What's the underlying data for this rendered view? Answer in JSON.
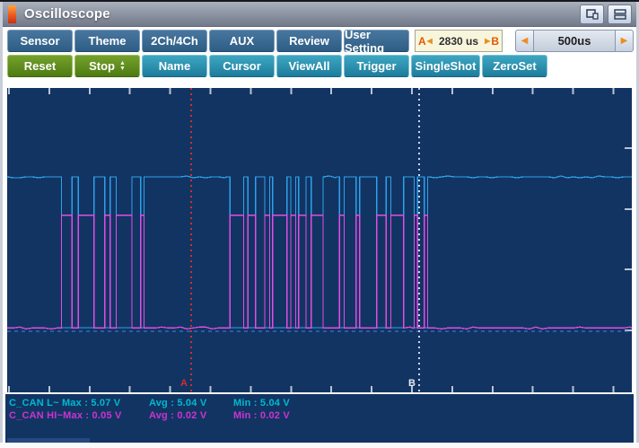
{
  "window": {
    "title": "Oscilloscope"
  },
  "icons": {
    "left_arrow": "◀",
    "right_arrow": "▶",
    "spinner_up": "▲",
    "spinner_down": "▼"
  },
  "toolbar": {
    "row1": [
      {
        "label": "Sensor"
      },
      {
        "label": "Theme"
      },
      {
        "label": "2Ch/4Ch"
      },
      {
        "label": "AUX"
      },
      {
        "label": "Review"
      },
      {
        "label": "User Setting"
      }
    ],
    "ab_readout": {
      "a": "A",
      "value": "2830 us",
      "b": "B"
    },
    "timebase": {
      "value": "500us"
    },
    "row2": [
      {
        "label": "Reset"
      },
      {
        "label": "Stop"
      },
      {
        "label": "Name"
      },
      {
        "label": "Cursor"
      },
      {
        "label": "ViewAll"
      },
      {
        "label": "Trigger"
      },
      {
        "label": "SingleShot"
      },
      {
        "label": "ZeroSet"
      }
    ]
  },
  "status": {
    "rows": [
      {
        "label_max": "C_CAN L~ Max : 5.07 V",
        "avg": "Avg : 5.04 V",
        "min": "Min : 5.04 V",
        "color": "#00bacf"
      },
      {
        "label_max": "C_CAN HI~Max : 0.05 V",
        "avg": "Avg : 0.02 V",
        "min": "Min : 0.02 V",
        "color": "#cd33d0"
      }
    ]
  },
  "chart_data": {
    "type": "line",
    "x_unit": "us",
    "time_span_us": 7750,
    "timebase_per_div": "500us",
    "cursor_delta": "2830 us",
    "cursors": [
      {
        "label": "A",
        "time_us": 2283,
        "color": "#cf2f2f"
      },
      {
        "label": "B",
        "time_us": 5113,
        "color": "#ccd5e2"
      }
    ],
    "signals": [
      {
        "name": "C_CAN L",
        "color": "#2da2ea",
        "idle_v": 5.0,
        "burst_low_v": 0.06,
        "max_v": 5.07,
        "avg_v": 5.04,
        "min_v": 5.04
      },
      {
        "name": "C_CAN HI",
        "color": "#e24de2",
        "idle_v": 0.05,
        "burst_high_v": 3.74,
        "max_v": 0.05,
        "avg_v": 0.02,
        "min_v": 0.02
      }
    ],
    "bursts_us": [
      {
        "t0": 635,
        "t1": 1548,
        "bit_min_us": 34,
        "bit_max_us": 80
      },
      {
        "t0": 1548,
        "t1": 1762,
        "bit_min_us": 14,
        "bit_max_us": 30
      },
      {
        "t0": 2728,
        "t1": 3920,
        "bit_min_us": 28,
        "bit_max_us": 64
      },
      {
        "t0": 4087,
        "t1": 4922,
        "bit_min_us": 28,
        "bit_max_us": 64
      },
      {
        "t0": 5022,
        "t1": 5233,
        "bit_min_us": 14,
        "bit_max_us": 30
      }
    ],
    "zero_reference_v": 0,
    "grid": {
      "top_bottom_tick_spacing_us": 500,
      "right_tick_divisions": 5,
      "background": "#123463"
    }
  }
}
